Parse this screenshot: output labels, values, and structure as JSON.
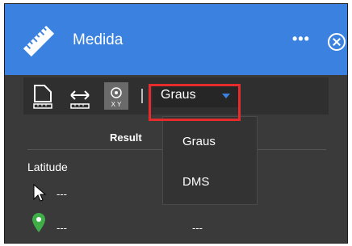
{
  "app": {
    "title": "Medida"
  },
  "header": {
    "more_label": "•••"
  },
  "toolbar": {
    "tools": [
      {
        "name": "area",
        "icon": "area-measure-icon"
      },
      {
        "name": "distance",
        "icon": "distance-measure-icon"
      },
      {
        "name": "location",
        "icon": "location-xy-icon",
        "label": "X Y",
        "active": true
      }
    ],
    "unit_select": {
      "value": "Graus"
    }
  },
  "results": {
    "label": "Result",
    "latitude_label": "Latitude",
    "values": [
      "---",
      "---",
      "---"
    ]
  },
  "dropdown": {
    "options": [
      "Graus",
      "DMS"
    ]
  },
  "colors": {
    "header": "#3b82e0",
    "panel": "#3a3a3a",
    "highlight": "#e52b2b",
    "accent": "#3b82e0"
  }
}
